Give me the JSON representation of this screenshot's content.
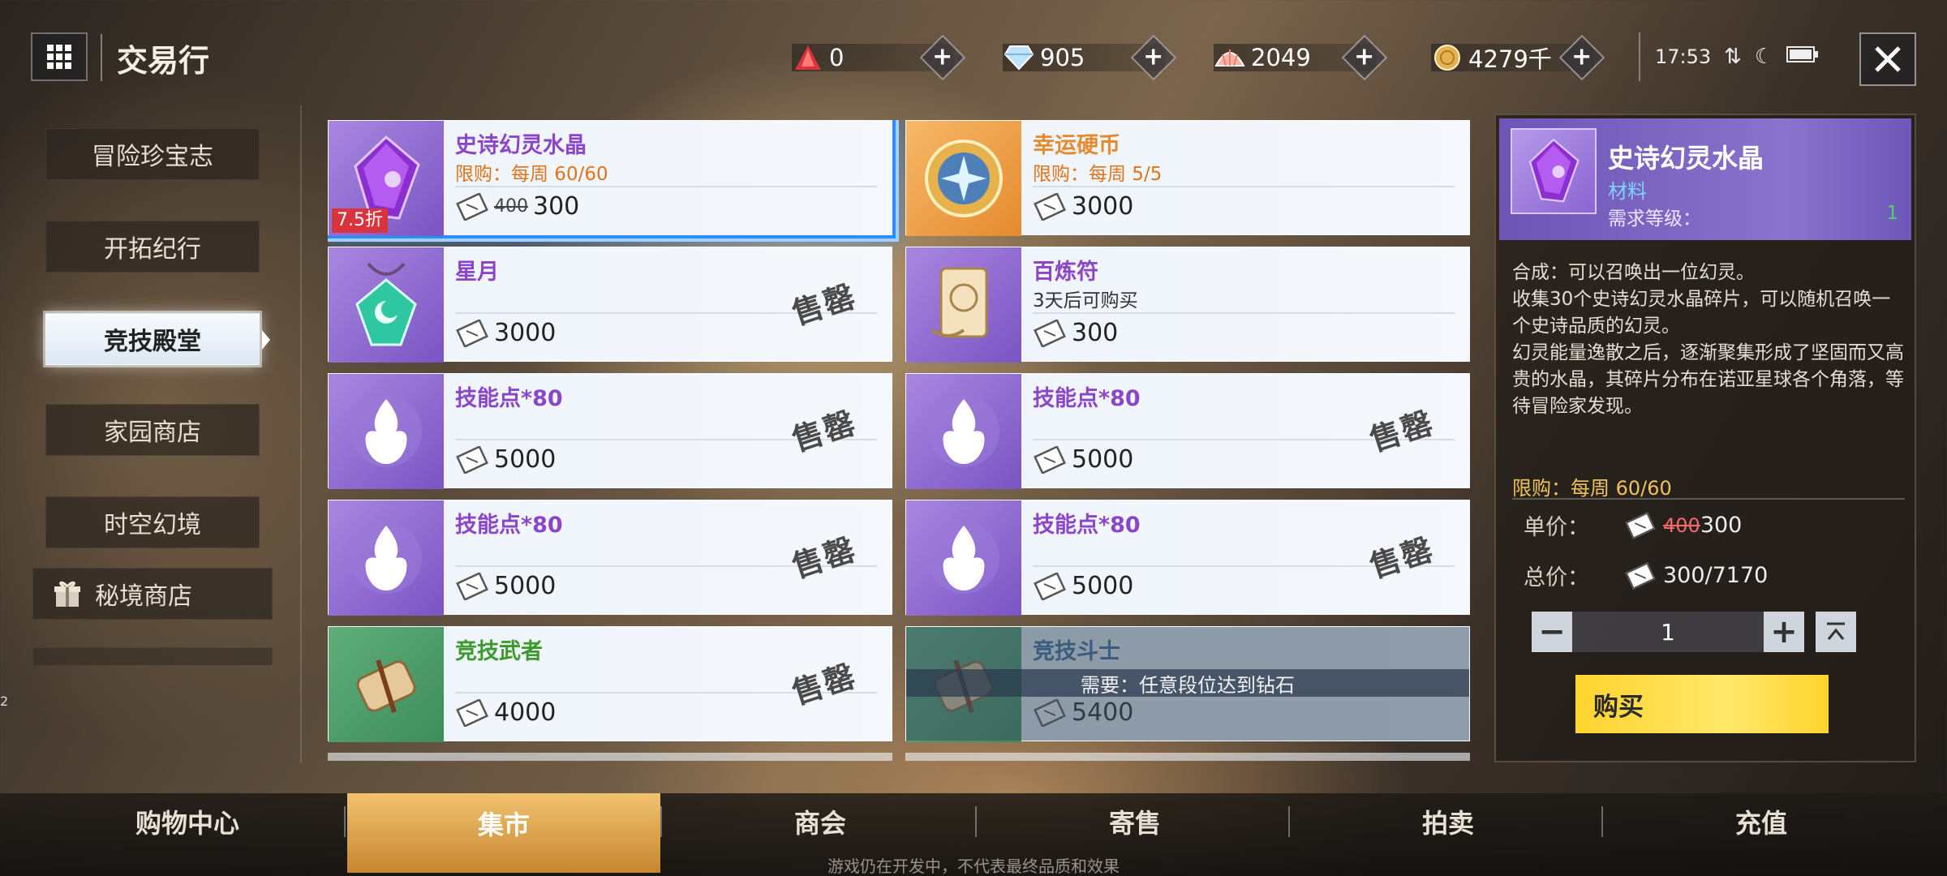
{
  "header": {
    "title": "交易行",
    "currencies": [
      {
        "icon": "red-crystal-icon",
        "value": "0",
        "color": "#d9333d"
      },
      {
        "icon": "diamond-icon",
        "value": "905",
        "color": "#bfe3ff"
      },
      {
        "icon": "shell-icon",
        "value": "2049",
        "color": "#ffb2a8"
      },
      {
        "icon": "gold-coin-icon",
        "value": "4279千",
        "color": "#e5b152"
      }
    ],
    "clock": "17:53"
  },
  "sidebar": {
    "items": [
      {
        "label": "冒险珍宝志"
      },
      {
        "label": "开拓纪行"
      },
      {
        "label": "竞技殿堂"
      },
      {
        "label": "家园商店"
      },
      {
        "label": "时空幻境"
      },
      {
        "label": "秘境商店"
      }
    ],
    "active_index": 2
  },
  "shop": {
    "stamp_label": "售罄",
    "items": [
      {
        "name": "史诗幻灵水晶",
        "limit": "限购：每周 60/60",
        "old_price": "400",
        "price": "300",
        "discount": "7.5折",
        "thumb_color": "purple",
        "name_color": "#8b45c8",
        "limit_color": "#e0741c"
      },
      {
        "name": "幸运硬币",
        "limit": "限购：每周 5/5",
        "price": "3000",
        "thumb_color": "orange",
        "name_color": "#e58a2e",
        "limit_color": "#e0741c"
      },
      {
        "name": "星月",
        "price": "3000",
        "thumb_color": "purple",
        "name_color": "#8b45c8",
        "sold_out": true
      },
      {
        "name": "百炼符",
        "limit": "3天后可购买",
        "price": "300",
        "thumb_color": "purple",
        "name_color": "#8b45c8",
        "limit_color": "#333"
      },
      {
        "name": "技能点*80",
        "price": "5000",
        "thumb_color": "purple",
        "name_color": "#8b45c8",
        "sold_out": true
      },
      {
        "name": "技能点*80",
        "price": "5000",
        "thumb_color": "purple",
        "name_color": "#8b45c8",
        "sold_out": true
      },
      {
        "name": "技能点*80",
        "price": "5000",
        "thumb_color": "purple",
        "name_color": "#8b45c8",
        "sold_out": true
      },
      {
        "name": "技能点*80",
        "price": "5000",
        "thumb_color": "purple",
        "name_color": "#8b45c8",
        "sold_out": true
      },
      {
        "name": "竞技武者",
        "price": "4000",
        "thumb_color": "green",
        "name_color": "#3a9b2c",
        "sold_out": true
      },
      {
        "name": "竞技斗士",
        "price": "5400",
        "thumb_color": "green",
        "name_color": "#3a6a9b",
        "locked_note": "需要：任意段位达到钻石"
      }
    ]
  },
  "detail": {
    "name": "史诗幻灵水晶",
    "type": "材料",
    "level_label": "需求等级：",
    "level": "1",
    "description": "合成：可以召唤出一位幻灵。\n收集30个史诗幻灵水晶碎片，可以随机召唤一个史诗品质的幻灵。\n幻灵能量逸散之后，逐渐聚集形成了坚固而又高贵的水晶，其碎片分布在诺亚星球各个角落，等待冒险家发现。",
    "limit": "限购：每周 60/60",
    "unit_label": "单价：",
    "unit_old": "400",
    "unit_price": "300",
    "total_label": "总价：",
    "total": "300/7170",
    "quantity": "1",
    "buy_label": "购买"
  },
  "bottom_tabs": [
    {
      "label": "购物中心"
    },
    {
      "label": "集市"
    },
    {
      "label": "商会"
    },
    {
      "label": "寄售"
    },
    {
      "label": "拍卖"
    },
    {
      "label": "充值"
    }
  ],
  "bottom_active_index": 1,
  "disclaimer": "游戏仍在开发中，不代表最终品质和效果",
  "side_mark": "2"
}
